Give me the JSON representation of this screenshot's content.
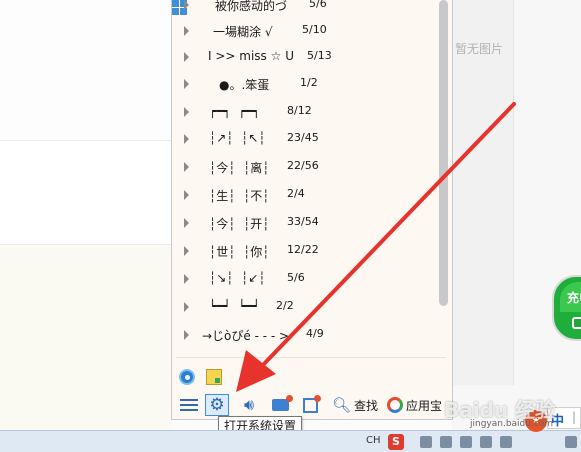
{
  "background": {
    "no_image_text": "暂无图片",
    "side_widget_text": "充电"
  },
  "menu": {
    "items": [
      {
        "name": "被你感动的づ",
        "count": "5/6"
      },
      {
        "name": "一場糊涂 √",
        "count": "5/10"
      },
      {
        "name": "I >> miss ☆ U",
        "count": "5/13"
      },
      {
        "name": "●。.笨蛋",
        "count": "1/2"
      },
      {
        "name": "┍━┑  ┍━┑",
        "count": "8/12"
      },
      {
        "name": "┆↗┆  ┆↖┆",
        "count": "23/45"
      },
      {
        "name": "┆今┆  ┆离┆",
        "count": "22/56"
      },
      {
        "name": "┆生┆  ┆不┆",
        "count": "2/4"
      },
      {
        "name": "┆今┆  ┆开┆",
        "count": "33/54"
      },
      {
        "name": "┆世┆  ┆你┆",
        "count": "12/22"
      },
      {
        "name": "┆↘┆  ┆↙┆",
        "count": "5/6"
      },
      {
        "name": "┕━┙  ┕━┙",
        "count": "2/2"
      },
      {
        "name": "→じòぴé - - - >",
        "count": "4/9"
      }
    ],
    "bottom": {
      "search_label": "查找",
      "appstore_label": "应用宝"
    },
    "tooltip": "打开系统设置"
  },
  "taskbar": {
    "lang": "CH",
    "sogou": "S",
    "ime_mode": "中"
  },
  "watermark": {
    "text": "Baidu 经验",
    "sub": "jingyan.baidu.com"
  },
  "icons": {
    "hamburger": "menu-icon",
    "gear": "gear-icon",
    "speaker": "speaker-icon",
    "folder": "folder-icon",
    "pin": "pin-icon",
    "search": "search-icon",
    "appstore": "appstore-icon"
  },
  "colors": {
    "accent": "#2f6bb3",
    "arrow": "#e8322c"
  }
}
